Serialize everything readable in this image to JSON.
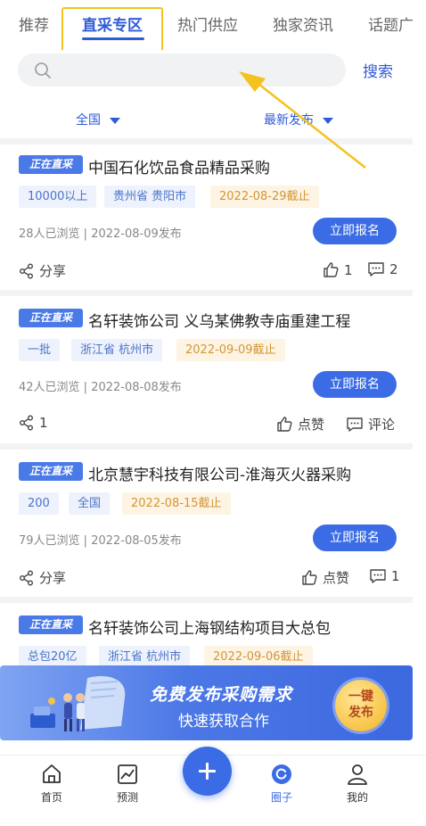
{
  "tabs": [
    "推荐",
    "直采专区",
    "热门供应",
    "独家资讯",
    "话题广"
  ],
  "search": {
    "placeholder": "",
    "button": "搜索"
  },
  "filters": {
    "region": "全国",
    "sort": "最新发布"
  },
  "cards": [
    {
      "badge": "正在直采",
      "title": "中国石化饮品食品精品采购",
      "tags": [
        "10000以上",
        "贵州省 贵阳市"
      ],
      "deadline": "2022-08-29截止",
      "views": "28人已浏览",
      "published": "2022-08-09发布",
      "apply": "立即报名",
      "share": "分享",
      "likes": "1",
      "comments": "2"
    },
    {
      "badge": "正在直采",
      "title": "名轩装饰公司 义乌某佛教寺庙重建工程",
      "tags": [
        "一批",
        "浙江省 杭州市"
      ],
      "deadline": "2022-09-09截止",
      "views": "42人已浏览",
      "published": "2022-08-08发布",
      "apply": "立即报名",
      "share": "1",
      "likes": "点赞",
      "comments": "评论"
    },
    {
      "badge": "正在直采",
      "title": "北京慧宇科技有限公司-淮海灭火器采购",
      "tags": [
        "200",
        "全国"
      ],
      "deadline": "2022-08-15截止",
      "views": "79人已浏览",
      "published": "2022-08-05发布",
      "apply": "立即报名",
      "share": "分享",
      "likes": "点赞",
      "comments": "1"
    },
    {
      "badge": "正在直采",
      "title": "名轩装饰公司上海钢结构项目大总包",
      "tags": [
        "总包20亿",
        "浙江省 杭州市"
      ],
      "deadline": "2022-09-06截止"
    }
  ],
  "banner": {
    "title": "免费发布采购需求",
    "subtitle": "快速获取合作",
    "button_line1": "一键",
    "button_line2": "发布"
  },
  "nav": [
    "首页",
    "预测",
    "圈子",
    "我的"
  ],
  "colors": {
    "accent": "#3B6CE6",
    "highlight": "#F4C21D"
  }
}
